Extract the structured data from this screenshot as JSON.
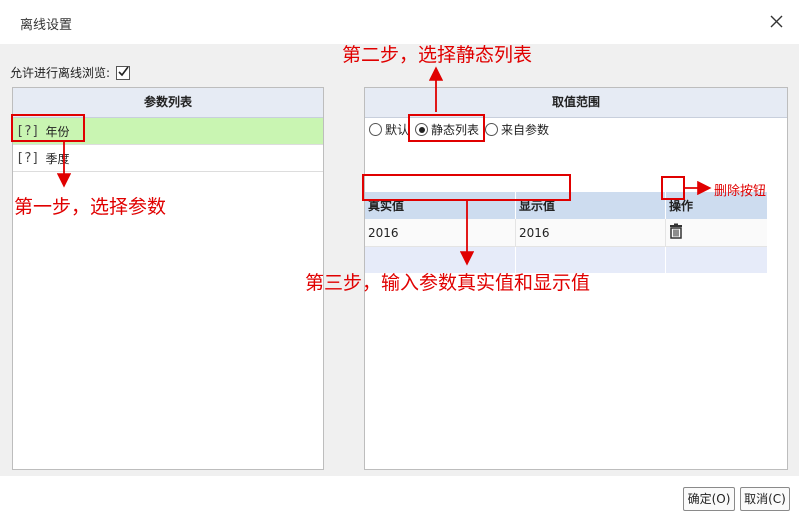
{
  "dialog": {
    "title": "离线设置"
  },
  "allow_offline": {
    "label": "允许进行离线浏览:",
    "checked": true
  },
  "params": {
    "header": "参数列表",
    "items": [
      {
        "label": "年份",
        "icon": "[?]",
        "selected": true
      },
      {
        "label": "季度",
        "icon": "[?]",
        "selected": false
      }
    ]
  },
  "range": {
    "header": "取值范围",
    "options": [
      {
        "label": "默认",
        "checked": false
      },
      {
        "label": "静态列表",
        "checked": true
      },
      {
        "label": "来自参数",
        "checked": false
      }
    ],
    "columns": [
      "真实值",
      "显示值",
      "操作"
    ],
    "rows": [
      {
        "real": "2016",
        "display": "2016"
      }
    ]
  },
  "annotations": {
    "step1": "第一步，选择参数",
    "step2": "第二步，选择静态列表",
    "step3": "第三步，输入参数真实值和显示值",
    "delete": "删除按钮"
  },
  "buttons": {
    "ok": "确定(O)",
    "cancel": "取消(C)"
  },
  "colors": {
    "annotation": "#e00000",
    "selected_row": "#c9f5b2",
    "table_header": "#cddcef"
  }
}
